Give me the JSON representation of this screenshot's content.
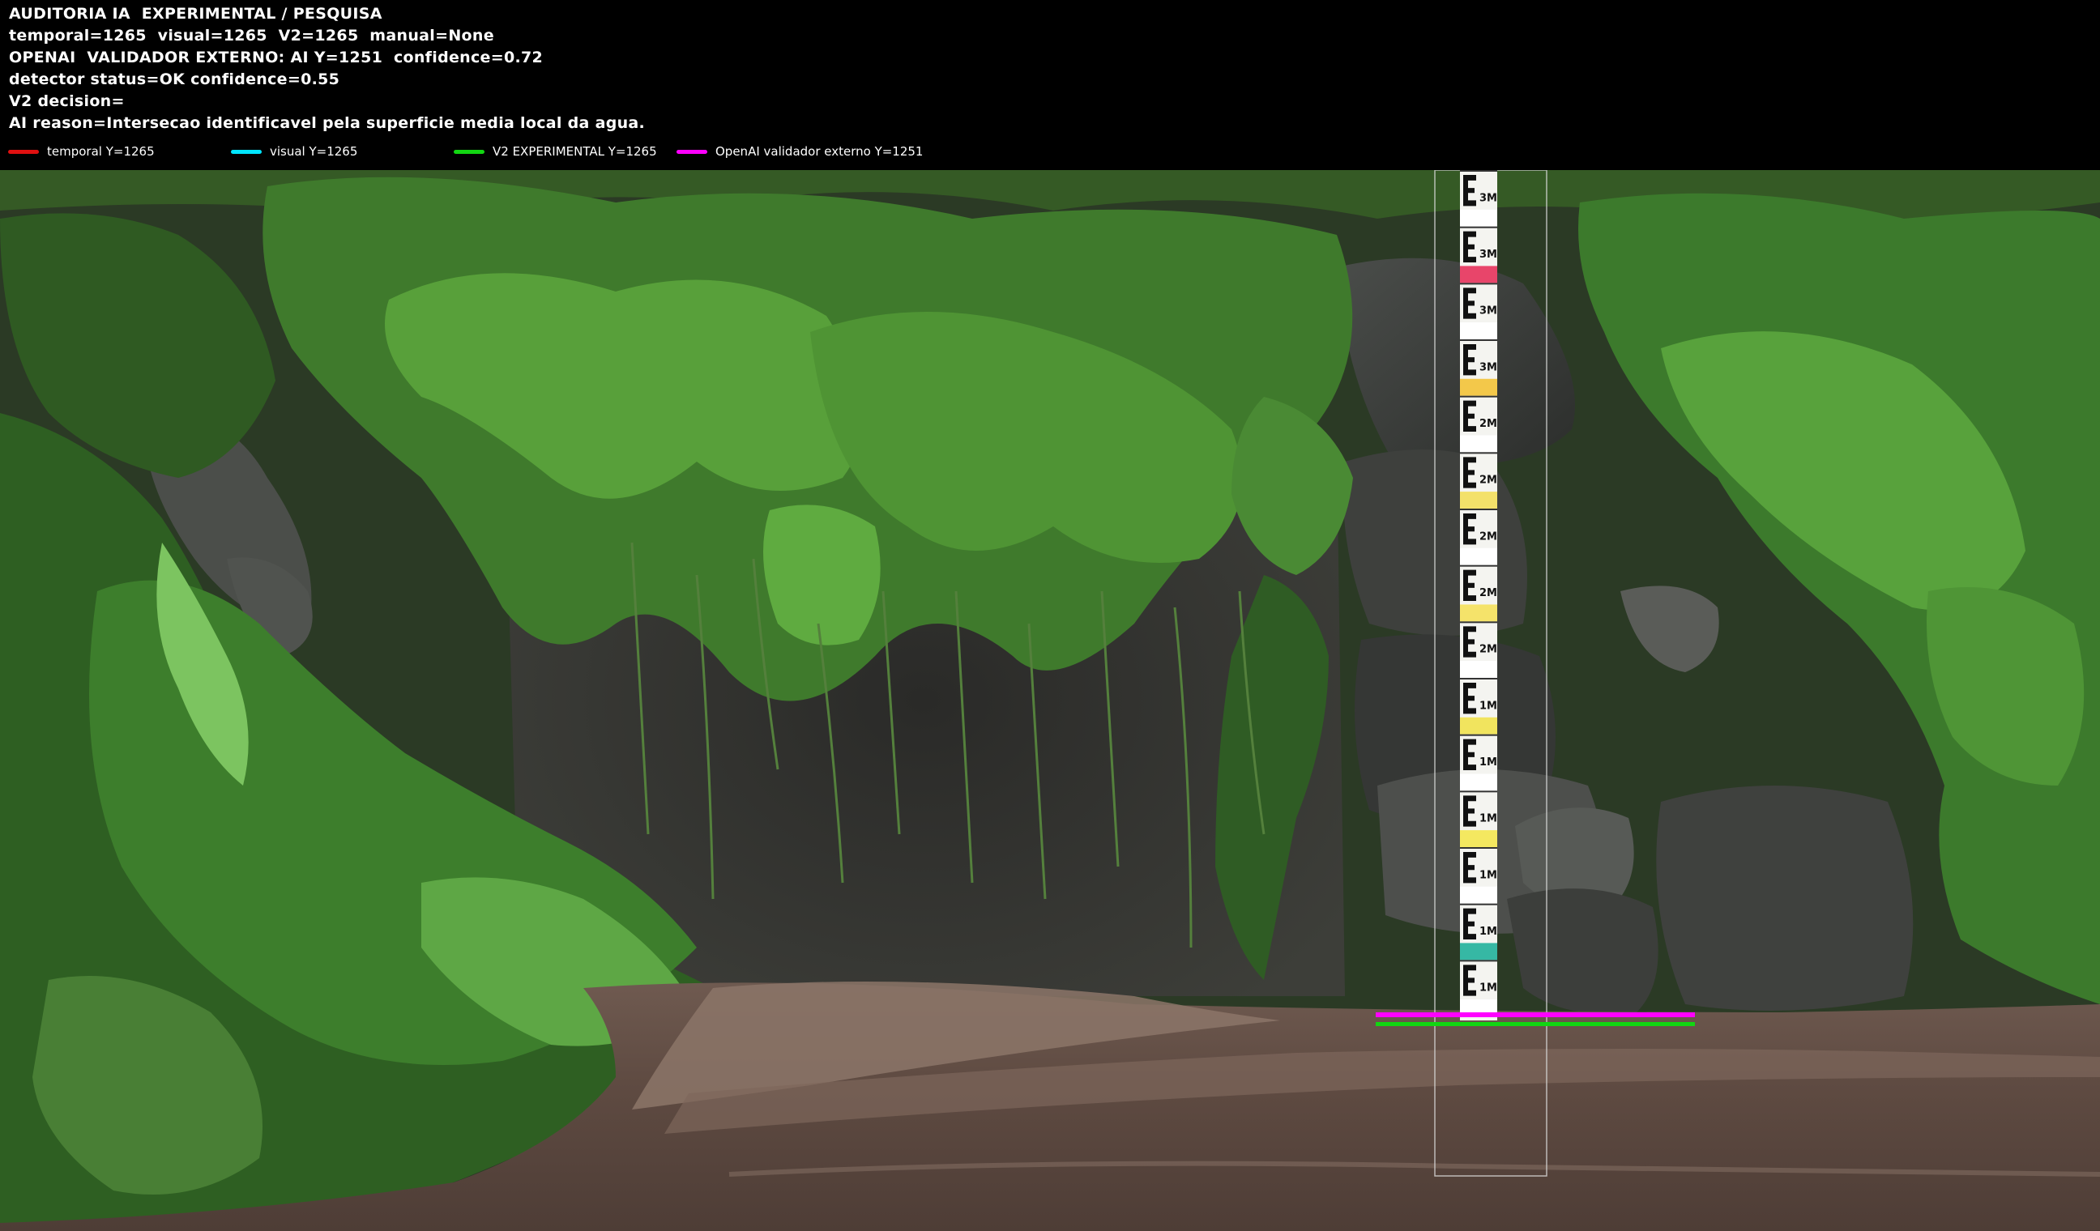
{
  "header": {
    "lines": [
      "AUDITORIA IA  EXPERIMENTAL / PESQUISA",
      "temporal=1265  visual=1265  V2=1265  manual=None",
      "OPENAI  VALIDADOR EXTERNO: AI Y=1251  confidence=0.72",
      "detector status=OK confidence=0.55",
      "V2 decision=",
      "AI reason=Intersecao identificavel pela superficie media local da agua."
    ]
  },
  "legend": [
    {
      "label": "temporal Y=1265",
      "color": "#e01010"
    },
    {
      "label": "visual Y=1265",
      "color": "#00e5ff"
    },
    {
      "label": "V2 EXPERIMENTAL Y=1265",
      "color": "#12d612"
    },
    {
      "label": "OpenAI validador externo Y=1251",
      "color": "#ff00ff"
    }
  ],
  "staff_gauge": {
    "marks": [
      "3M",
      "3M",
      "3M",
      "3M",
      "2M",
      "2M",
      "2M",
      "2M",
      "2M",
      "1M",
      "1M",
      "1M",
      "1M",
      "1M",
      "1M"
    ],
    "segment_colors": [
      "#ffffff",
      "#e8456a",
      "#ffffff",
      "#f3c84a",
      "#ffffff",
      "#f3e16a",
      "#ffffff",
      "#f5e36a",
      "#ffffff",
      "#f1e45e",
      "#ffffff",
      "#f4e860",
      "#ffffff",
      "#36b8a4",
      "#ffffff"
    ]
  },
  "overlay_colors": {
    "magenta": "#ff00ff",
    "green": "#12d612",
    "guide": "#d8d8d8"
  }
}
